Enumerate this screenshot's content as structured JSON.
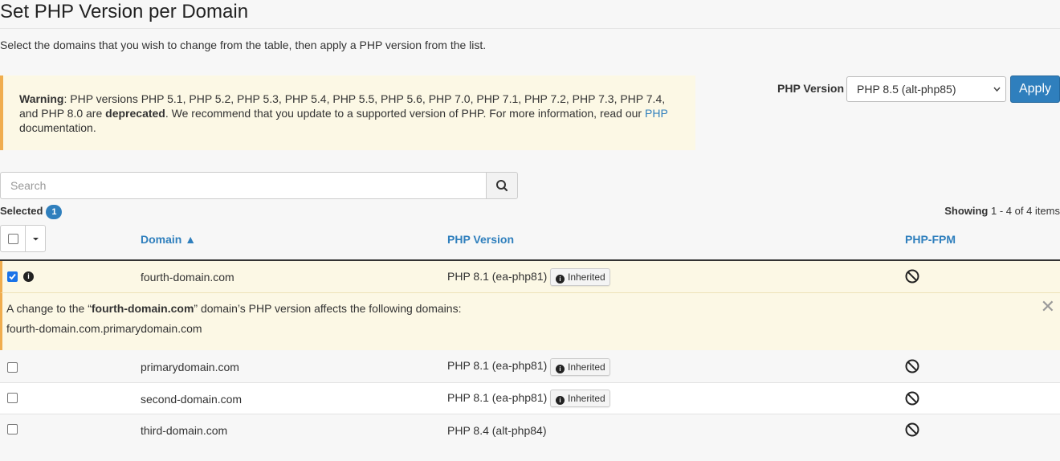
{
  "page": {
    "title": "Set PHP Version per Domain",
    "subtitle": "Select the domains that you wish to change from the table, then apply a PHP version from the list."
  },
  "warning": {
    "strong": "Warning",
    "text1": ": PHP versions PHP 5.1, PHP 5.2, PHP 5.3, PHP 5.4, PHP 5.5, PHP 5.6, PHP 7.0, PHP 7.1, PHP 7.2, PHP 7.3, PHP 7.4, and PHP 8.0 are ",
    "deprecated": "deprecated",
    "text2": ". We recommend that you update to a supported version of PHP. For more information, read our ",
    "link": "PHP",
    "text3": " documentation."
  },
  "php_version": {
    "label": "PHP Version",
    "selected": "PHP 8.5 (alt-php85)",
    "apply_label": "Apply"
  },
  "search": {
    "placeholder": "Search"
  },
  "selection": {
    "label": "Selected",
    "count": "1"
  },
  "showing": {
    "label": "Showing",
    "range": "1 - 4 of 4 items"
  },
  "columns": {
    "domain": "Domain ▲",
    "php_version": "PHP Version",
    "php_fpm": "PHP-FPM"
  },
  "inherited_label": "Inherited",
  "rows": [
    {
      "domain": "fourth-domain.com",
      "php": "PHP 8.1 (ea-php81)",
      "checked": true,
      "inherited": true
    },
    {
      "domain": "primarydomain.com",
      "php": "PHP 8.1 (ea-php81)",
      "checked": false,
      "inherited": true
    },
    {
      "domain": "second-domain.com",
      "php": "PHP 8.1 (ea-php81)",
      "checked": false,
      "inherited": true
    },
    {
      "domain": "third-domain.com",
      "php": "PHP 8.4 (alt-php84)",
      "checked": false,
      "inherited": false
    }
  ],
  "notice": {
    "prefix": "A change to the “",
    "domain": "fourth-domain.com",
    "suffix": "” domain’s PHP version affects the following domains:",
    "affected": "fourth-domain.com.primarydomain.com"
  },
  "colors": {
    "accent": "#2f7fbd",
    "warning_bg": "#fcf8e5",
    "warning_border": "#f0ad4e"
  }
}
